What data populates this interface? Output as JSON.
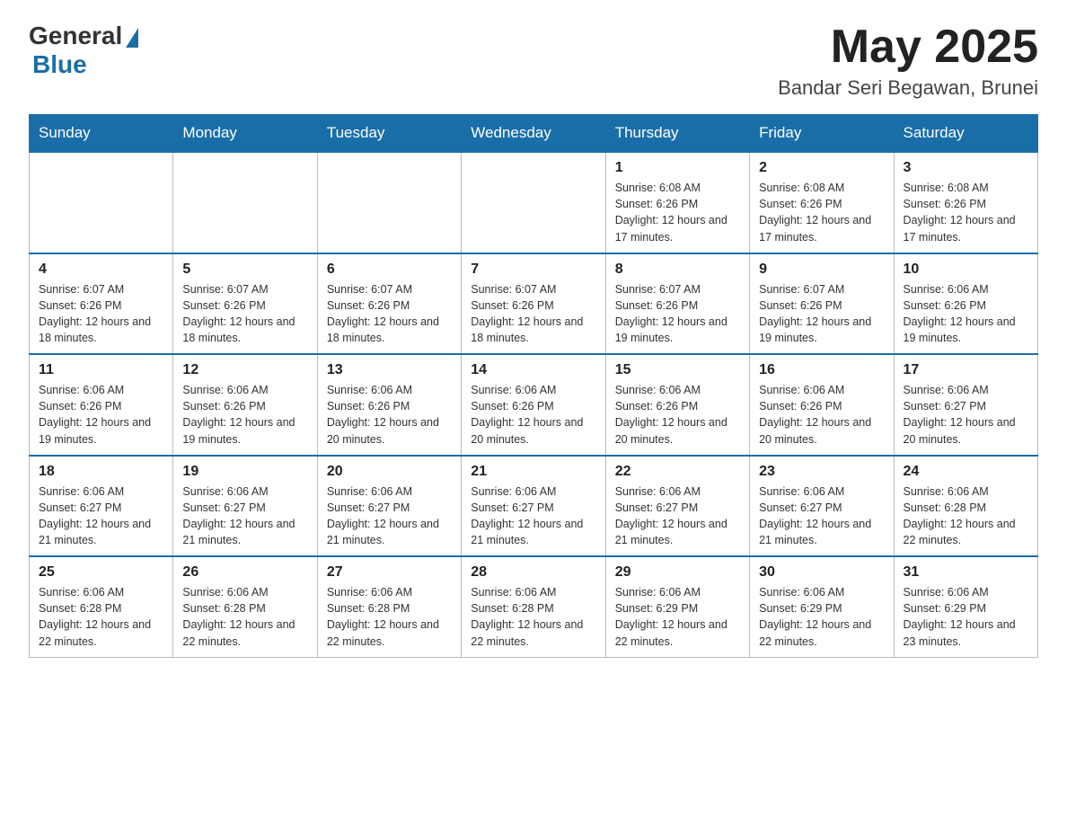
{
  "header": {
    "logo_general": "General",
    "logo_blue": "Blue",
    "month_title": "May 2025",
    "location": "Bandar Seri Begawan, Brunei"
  },
  "weekdays": [
    "Sunday",
    "Monday",
    "Tuesday",
    "Wednesday",
    "Thursday",
    "Friday",
    "Saturday"
  ],
  "weeks": [
    [
      {
        "day": "",
        "info": ""
      },
      {
        "day": "",
        "info": ""
      },
      {
        "day": "",
        "info": ""
      },
      {
        "day": "",
        "info": ""
      },
      {
        "day": "1",
        "info": "Sunrise: 6:08 AM\nSunset: 6:26 PM\nDaylight: 12 hours and 17 minutes."
      },
      {
        "day": "2",
        "info": "Sunrise: 6:08 AM\nSunset: 6:26 PM\nDaylight: 12 hours and 17 minutes."
      },
      {
        "day": "3",
        "info": "Sunrise: 6:08 AM\nSunset: 6:26 PM\nDaylight: 12 hours and 17 minutes."
      }
    ],
    [
      {
        "day": "4",
        "info": "Sunrise: 6:07 AM\nSunset: 6:26 PM\nDaylight: 12 hours and 18 minutes."
      },
      {
        "day": "5",
        "info": "Sunrise: 6:07 AM\nSunset: 6:26 PM\nDaylight: 12 hours and 18 minutes."
      },
      {
        "day": "6",
        "info": "Sunrise: 6:07 AM\nSunset: 6:26 PM\nDaylight: 12 hours and 18 minutes."
      },
      {
        "day": "7",
        "info": "Sunrise: 6:07 AM\nSunset: 6:26 PM\nDaylight: 12 hours and 18 minutes."
      },
      {
        "day": "8",
        "info": "Sunrise: 6:07 AM\nSunset: 6:26 PM\nDaylight: 12 hours and 19 minutes."
      },
      {
        "day": "9",
        "info": "Sunrise: 6:07 AM\nSunset: 6:26 PM\nDaylight: 12 hours and 19 minutes."
      },
      {
        "day": "10",
        "info": "Sunrise: 6:06 AM\nSunset: 6:26 PM\nDaylight: 12 hours and 19 minutes."
      }
    ],
    [
      {
        "day": "11",
        "info": "Sunrise: 6:06 AM\nSunset: 6:26 PM\nDaylight: 12 hours and 19 minutes."
      },
      {
        "day": "12",
        "info": "Sunrise: 6:06 AM\nSunset: 6:26 PM\nDaylight: 12 hours and 19 minutes."
      },
      {
        "day": "13",
        "info": "Sunrise: 6:06 AM\nSunset: 6:26 PM\nDaylight: 12 hours and 20 minutes."
      },
      {
        "day": "14",
        "info": "Sunrise: 6:06 AM\nSunset: 6:26 PM\nDaylight: 12 hours and 20 minutes."
      },
      {
        "day": "15",
        "info": "Sunrise: 6:06 AM\nSunset: 6:26 PM\nDaylight: 12 hours and 20 minutes."
      },
      {
        "day": "16",
        "info": "Sunrise: 6:06 AM\nSunset: 6:26 PM\nDaylight: 12 hours and 20 minutes."
      },
      {
        "day": "17",
        "info": "Sunrise: 6:06 AM\nSunset: 6:27 PM\nDaylight: 12 hours and 20 minutes."
      }
    ],
    [
      {
        "day": "18",
        "info": "Sunrise: 6:06 AM\nSunset: 6:27 PM\nDaylight: 12 hours and 21 minutes."
      },
      {
        "day": "19",
        "info": "Sunrise: 6:06 AM\nSunset: 6:27 PM\nDaylight: 12 hours and 21 minutes."
      },
      {
        "day": "20",
        "info": "Sunrise: 6:06 AM\nSunset: 6:27 PM\nDaylight: 12 hours and 21 minutes."
      },
      {
        "day": "21",
        "info": "Sunrise: 6:06 AM\nSunset: 6:27 PM\nDaylight: 12 hours and 21 minutes."
      },
      {
        "day": "22",
        "info": "Sunrise: 6:06 AM\nSunset: 6:27 PM\nDaylight: 12 hours and 21 minutes."
      },
      {
        "day": "23",
        "info": "Sunrise: 6:06 AM\nSunset: 6:27 PM\nDaylight: 12 hours and 21 minutes."
      },
      {
        "day": "24",
        "info": "Sunrise: 6:06 AM\nSunset: 6:28 PM\nDaylight: 12 hours and 22 minutes."
      }
    ],
    [
      {
        "day": "25",
        "info": "Sunrise: 6:06 AM\nSunset: 6:28 PM\nDaylight: 12 hours and 22 minutes."
      },
      {
        "day": "26",
        "info": "Sunrise: 6:06 AM\nSunset: 6:28 PM\nDaylight: 12 hours and 22 minutes."
      },
      {
        "day": "27",
        "info": "Sunrise: 6:06 AM\nSunset: 6:28 PM\nDaylight: 12 hours and 22 minutes."
      },
      {
        "day": "28",
        "info": "Sunrise: 6:06 AM\nSunset: 6:28 PM\nDaylight: 12 hours and 22 minutes."
      },
      {
        "day": "29",
        "info": "Sunrise: 6:06 AM\nSunset: 6:29 PM\nDaylight: 12 hours and 22 minutes."
      },
      {
        "day": "30",
        "info": "Sunrise: 6:06 AM\nSunset: 6:29 PM\nDaylight: 12 hours and 22 minutes."
      },
      {
        "day": "31",
        "info": "Sunrise: 6:06 AM\nSunset: 6:29 PM\nDaylight: 12 hours and 23 minutes."
      }
    ]
  ]
}
